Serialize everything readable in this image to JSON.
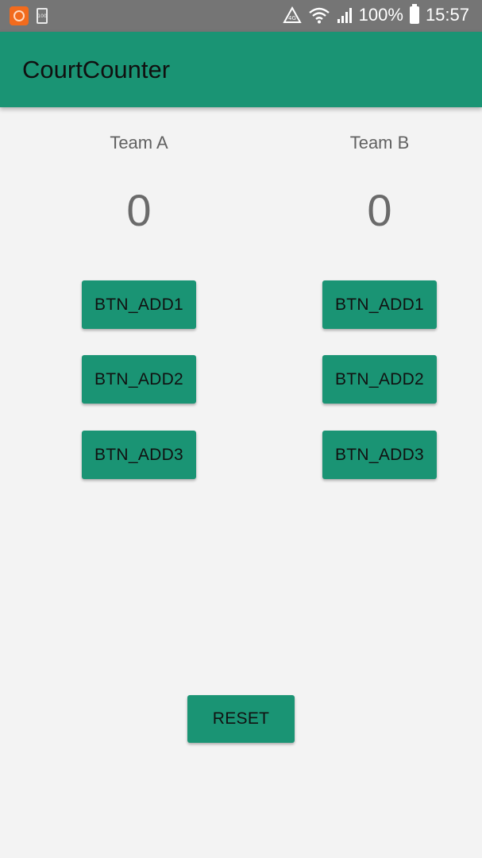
{
  "status_bar": {
    "battery_percent": "100%",
    "time": "15:57",
    "icons": [
      "app-notification-icon",
      "battery-saver-icon",
      "data-saver-icon",
      "wifi-icon",
      "signal-icon",
      "battery-icon"
    ]
  },
  "app_bar": {
    "title": "CourtCounter"
  },
  "team_a": {
    "name": "Team A",
    "score": "0",
    "buttons": [
      "BTN_ADD1",
      "BTN_ADD2",
      "BTN_ADD3"
    ]
  },
  "team_b": {
    "name": "Team B",
    "score": "0",
    "buttons": [
      "BTN_ADD1",
      "BTN_ADD2",
      "BTN_ADD3"
    ]
  },
  "reset_label": "RESET",
  "colors": {
    "primary": "#1a9474",
    "status_bar": "#757575",
    "background": "#f3f3f3",
    "notification_accent": "#f26b1d"
  }
}
